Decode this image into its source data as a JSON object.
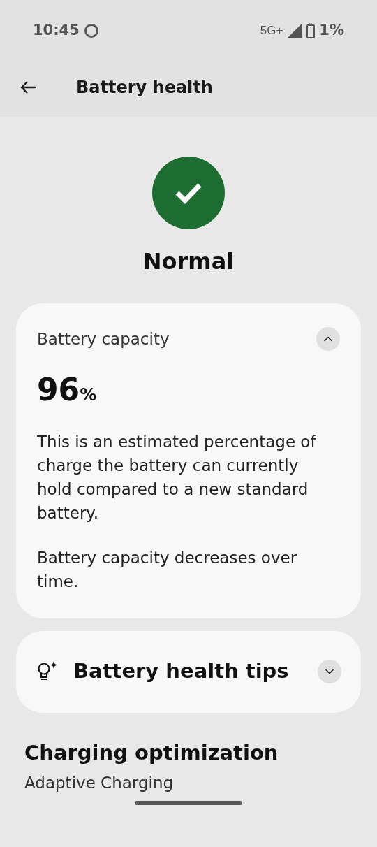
{
  "status_bar": {
    "time": "10:45",
    "network": "5G+",
    "battery": "1%"
  },
  "app_bar": {
    "title": "Battery health"
  },
  "status": {
    "label": "Normal"
  },
  "capacity_card": {
    "title": "Battery capacity",
    "expanded": true,
    "value": "96",
    "unit": "%",
    "paragraphs": [
      "This is an estimated percentage of charge the battery can currently hold compared to a new standard battery.",
      "Battery capacity decreases over time."
    ]
  },
  "tips_card": {
    "title": "Battery health tips",
    "expanded": false
  },
  "section": {
    "title": "Charging optimization",
    "subtitle": "Adaptive Charging"
  }
}
